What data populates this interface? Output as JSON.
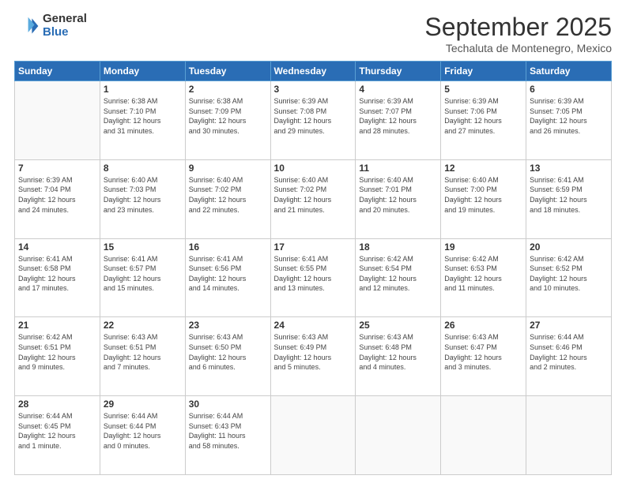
{
  "logo": {
    "general": "General",
    "blue": "Blue"
  },
  "header": {
    "month": "September 2025",
    "location": "Techaluta de Montenegro, Mexico"
  },
  "weekdays": [
    "Sunday",
    "Monday",
    "Tuesday",
    "Wednesday",
    "Thursday",
    "Friday",
    "Saturday"
  ],
  "weeks": [
    [
      {
        "day": "",
        "info": ""
      },
      {
        "day": "1",
        "info": "Sunrise: 6:38 AM\nSunset: 7:10 PM\nDaylight: 12 hours\nand 31 minutes."
      },
      {
        "day": "2",
        "info": "Sunrise: 6:38 AM\nSunset: 7:09 PM\nDaylight: 12 hours\nand 30 minutes."
      },
      {
        "day": "3",
        "info": "Sunrise: 6:39 AM\nSunset: 7:08 PM\nDaylight: 12 hours\nand 29 minutes."
      },
      {
        "day": "4",
        "info": "Sunrise: 6:39 AM\nSunset: 7:07 PM\nDaylight: 12 hours\nand 28 minutes."
      },
      {
        "day": "5",
        "info": "Sunrise: 6:39 AM\nSunset: 7:06 PM\nDaylight: 12 hours\nand 27 minutes."
      },
      {
        "day": "6",
        "info": "Sunrise: 6:39 AM\nSunset: 7:05 PM\nDaylight: 12 hours\nand 26 minutes."
      }
    ],
    [
      {
        "day": "7",
        "info": "Sunrise: 6:39 AM\nSunset: 7:04 PM\nDaylight: 12 hours\nand 24 minutes."
      },
      {
        "day": "8",
        "info": "Sunrise: 6:40 AM\nSunset: 7:03 PM\nDaylight: 12 hours\nand 23 minutes."
      },
      {
        "day": "9",
        "info": "Sunrise: 6:40 AM\nSunset: 7:02 PM\nDaylight: 12 hours\nand 22 minutes."
      },
      {
        "day": "10",
        "info": "Sunrise: 6:40 AM\nSunset: 7:02 PM\nDaylight: 12 hours\nand 21 minutes."
      },
      {
        "day": "11",
        "info": "Sunrise: 6:40 AM\nSunset: 7:01 PM\nDaylight: 12 hours\nand 20 minutes."
      },
      {
        "day": "12",
        "info": "Sunrise: 6:40 AM\nSunset: 7:00 PM\nDaylight: 12 hours\nand 19 minutes."
      },
      {
        "day": "13",
        "info": "Sunrise: 6:41 AM\nSunset: 6:59 PM\nDaylight: 12 hours\nand 18 minutes."
      }
    ],
    [
      {
        "day": "14",
        "info": "Sunrise: 6:41 AM\nSunset: 6:58 PM\nDaylight: 12 hours\nand 17 minutes."
      },
      {
        "day": "15",
        "info": "Sunrise: 6:41 AM\nSunset: 6:57 PM\nDaylight: 12 hours\nand 15 minutes."
      },
      {
        "day": "16",
        "info": "Sunrise: 6:41 AM\nSunset: 6:56 PM\nDaylight: 12 hours\nand 14 minutes."
      },
      {
        "day": "17",
        "info": "Sunrise: 6:41 AM\nSunset: 6:55 PM\nDaylight: 12 hours\nand 13 minutes."
      },
      {
        "day": "18",
        "info": "Sunrise: 6:42 AM\nSunset: 6:54 PM\nDaylight: 12 hours\nand 12 minutes."
      },
      {
        "day": "19",
        "info": "Sunrise: 6:42 AM\nSunset: 6:53 PM\nDaylight: 12 hours\nand 11 minutes."
      },
      {
        "day": "20",
        "info": "Sunrise: 6:42 AM\nSunset: 6:52 PM\nDaylight: 12 hours\nand 10 minutes."
      }
    ],
    [
      {
        "day": "21",
        "info": "Sunrise: 6:42 AM\nSunset: 6:51 PM\nDaylight: 12 hours\nand 9 minutes."
      },
      {
        "day": "22",
        "info": "Sunrise: 6:43 AM\nSunset: 6:51 PM\nDaylight: 12 hours\nand 7 minutes."
      },
      {
        "day": "23",
        "info": "Sunrise: 6:43 AM\nSunset: 6:50 PM\nDaylight: 12 hours\nand 6 minutes."
      },
      {
        "day": "24",
        "info": "Sunrise: 6:43 AM\nSunset: 6:49 PM\nDaylight: 12 hours\nand 5 minutes."
      },
      {
        "day": "25",
        "info": "Sunrise: 6:43 AM\nSunset: 6:48 PM\nDaylight: 12 hours\nand 4 minutes."
      },
      {
        "day": "26",
        "info": "Sunrise: 6:43 AM\nSunset: 6:47 PM\nDaylight: 12 hours\nand 3 minutes."
      },
      {
        "day": "27",
        "info": "Sunrise: 6:44 AM\nSunset: 6:46 PM\nDaylight: 12 hours\nand 2 minutes."
      }
    ],
    [
      {
        "day": "28",
        "info": "Sunrise: 6:44 AM\nSunset: 6:45 PM\nDaylight: 12 hours\nand 1 minute."
      },
      {
        "day": "29",
        "info": "Sunrise: 6:44 AM\nSunset: 6:44 PM\nDaylight: 12 hours\nand 0 minutes."
      },
      {
        "day": "30",
        "info": "Sunrise: 6:44 AM\nSunset: 6:43 PM\nDaylight: 11 hours\nand 58 minutes."
      },
      {
        "day": "",
        "info": ""
      },
      {
        "day": "",
        "info": ""
      },
      {
        "day": "",
        "info": ""
      },
      {
        "day": "",
        "info": ""
      }
    ]
  ]
}
